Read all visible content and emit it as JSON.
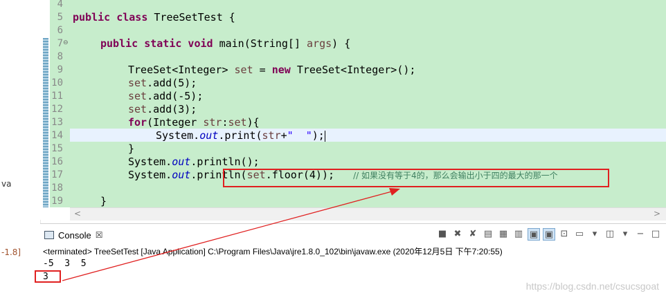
{
  "left_panel": {
    "snippet_1": "va",
    "snippet_2": "-1.8]"
  },
  "editor": {
    "lines": [
      {
        "num": "4"
      },
      {
        "num": "5"
      },
      {
        "num": "6"
      },
      {
        "num": "7"
      },
      {
        "num": "8"
      },
      {
        "num": "9"
      },
      {
        "num": "10"
      },
      {
        "num": "11"
      },
      {
        "num": "12"
      },
      {
        "num": "13"
      },
      {
        "num": "14"
      },
      {
        "num": "15"
      },
      {
        "num": "16"
      },
      {
        "num": "17"
      },
      {
        "num": "18"
      },
      {
        "num": "19"
      }
    ],
    "code": {
      "l5_kw": "public class",
      "l5_rest": " TreeSetTest {",
      "l7_kw": "public static void",
      "l7_a": " main(String[] ",
      "l7_var": "args",
      "l7_b": ") {",
      "l9_a": "TreeSet<Integer> ",
      "l9_var": "set",
      "l9_b": " = ",
      "l9_kw": "new",
      "l9_c": " TreeSet<Integer>();",
      "l10_var": "set",
      "l10_rest": ".add(5);",
      "l11_var": "set",
      "l11_rest": ".add(-5);",
      "l12_var": "set",
      "l12_rest": ".add(3);",
      "l13_kw": "for",
      "l13_a": "(Integer ",
      "l13_var1": "str",
      "l13_b": ":",
      "l13_var2": "set",
      "l13_c": "){",
      "l14_a": "System.",
      "l14_fld": "out",
      "l14_b": ".print(",
      "l14_var": "str",
      "l14_c": "+",
      "l14_str": "\"  \"",
      "l14_d": ");",
      "l15": "}",
      "l16_a": "System.",
      "l16_fld": "out",
      "l16_b": ".println();",
      "l17_a": "System.",
      "l17_fld": "out",
      "l17_b": ".println(",
      "l17_var": "set",
      "l17_c": ".floor(4));",
      "l17_cmt": "// 如果没有等于4的，那么会输出小于四的最大的那一个",
      "l19": "}"
    }
  },
  "console": {
    "tab_label": "Console",
    "tab_close": "☒",
    "terminated_line": "<terminated> TreeSetTest [Java Application] C:\\Program Files\\Java\\jre1.8.0_102\\bin\\javaw.exe (2020年12月5日 下午7:20:55)",
    "output_line_1": "-5  3  5",
    "output_line_2": "3",
    "toolbar": [
      "stop-icon",
      "remove-launch-icon",
      "remove-all-icon",
      "clear-icon",
      "scroll-lock-icon",
      "word-wrap-icon",
      "pin-icon",
      "show-when-stdout-icon",
      "display-console-icon",
      "open-console-icon",
      "new-console-icon",
      "view-menu-icon",
      "minimize-icon",
      "maximize-icon"
    ]
  },
  "annotations": {
    "highlight_color": "#e02020"
  },
  "watermark": "https://blog.csdn.net/csucsgoat"
}
